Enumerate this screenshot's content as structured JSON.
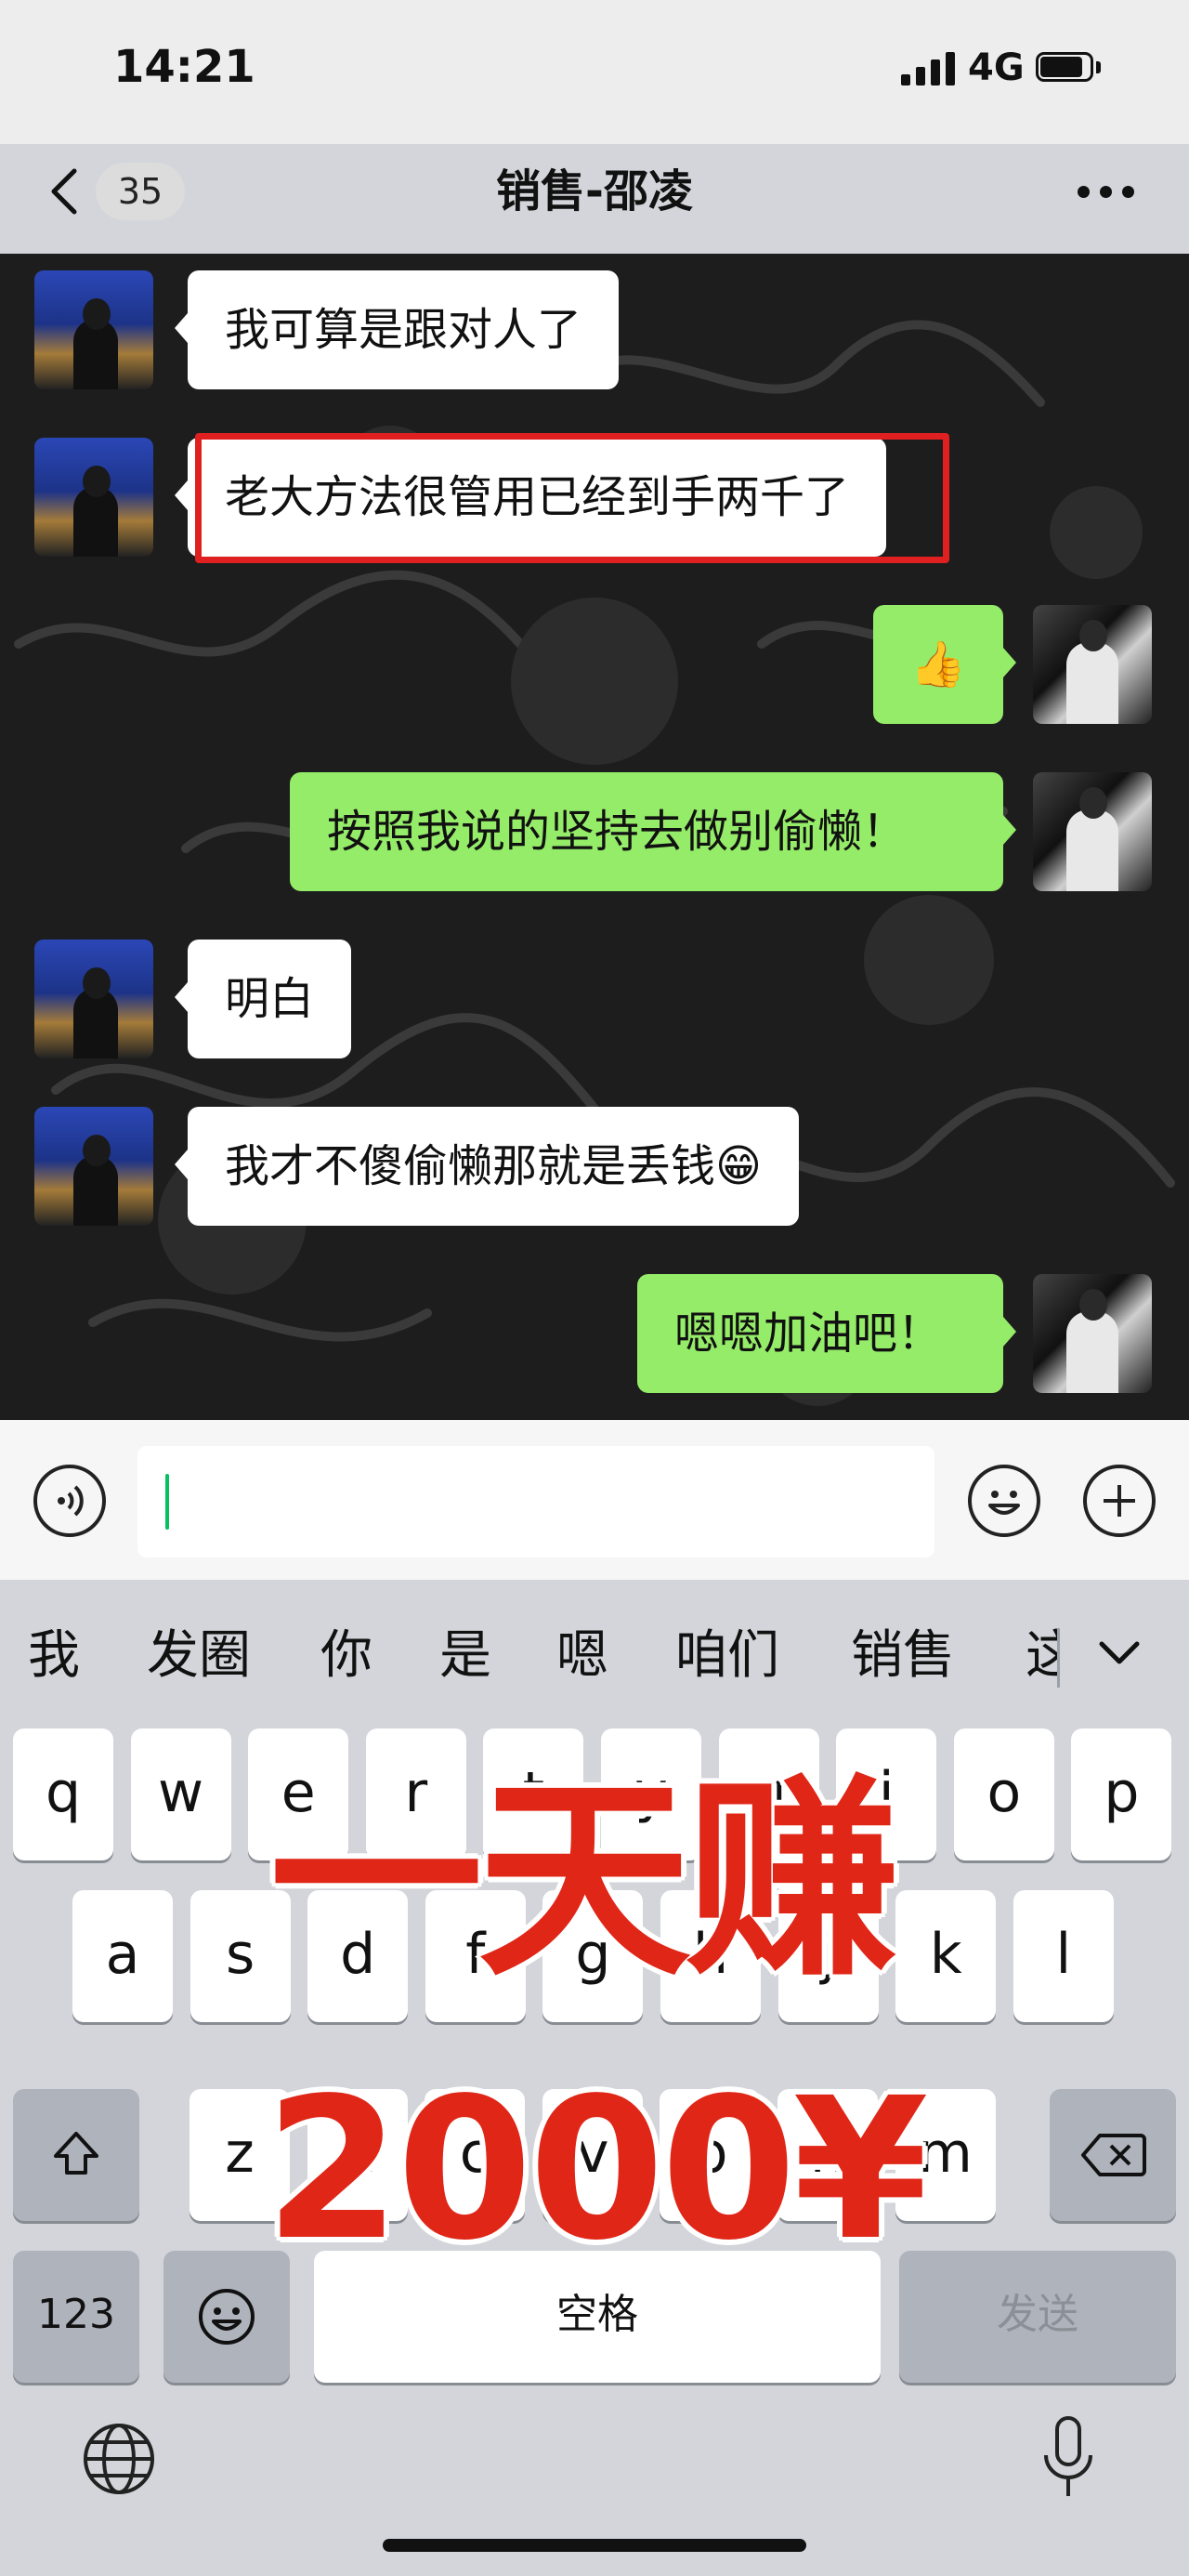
{
  "status_bar": {
    "time": "14:21",
    "network": "4G"
  },
  "nav": {
    "back_count": "35",
    "title": "销售-邵凌",
    "icons": [
      "chevron-left-icon",
      "more-icon"
    ]
  },
  "messages": [
    {
      "side": "in",
      "text": "我可算是跟对人了"
    },
    {
      "side": "in",
      "text": "老大方法很管用已经到手两千了",
      "highlighted": true
    },
    {
      "side": "out",
      "text": "👍"
    },
    {
      "side": "out",
      "text": "按照我说的坚持去做别偷懒！"
    },
    {
      "side": "in",
      "text": "明白"
    },
    {
      "side": "in",
      "text": "我才不傻偷懒那就是丢钱😁"
    },
    {
      "side": "out",
      "text": "嗯嗯加油吧！"
    }
  ],
  "input_bar": {
    "icons": [
      "voice-icon",
      "emoji-icon",
      "plus-icon"
    ]
  },
  "keyboard": {
    "suggestions": [
      "我",
      "发圈",
      "你",
      "是",
      "嗯",
      "咱们",
      "销售",
      "这"
    ],
    "row1": [
      "q",
      "w",
      "e",
      "r",
      "t",
      "y",
      "u",
      "i",
      "o",
      "p"
    ],
    "row2": [
      "a",
      "s",
      "d",
      "f",
      "g",
      "h",
      "j",
      "k",
      "l"
    ],
    "row3": [
      "z",
      "x",
      "c",
      "v",
      "b",
      "n",
      "m"
    ],
    "numbers_label": "123",
    "space_label": "空格",
    "send_label": "发送"
  },
  "overlay": {
    "line1": "一天赚",
    "line2": "2000¥"
  },
  "colors": {
    "outgoing_bubble": "#95ec69",
    "incoming_bubble": "#ffffff",
    "highlight": "#e02020",
    "overlay_text": "#e02617"
  }
}
